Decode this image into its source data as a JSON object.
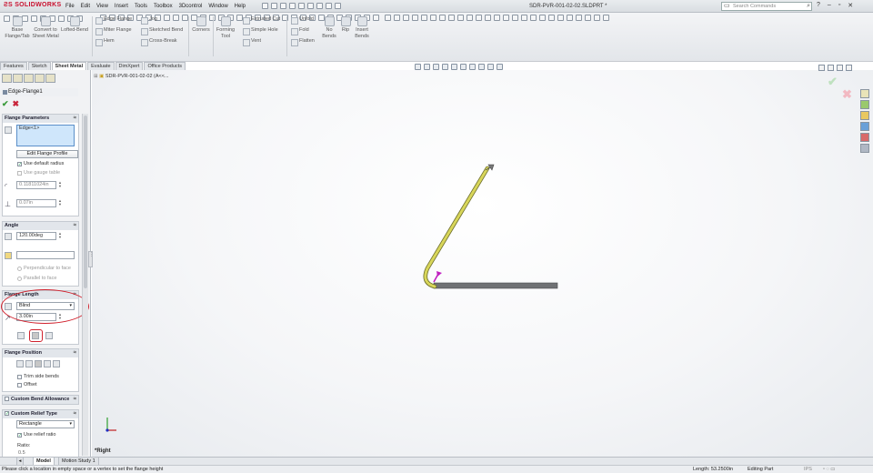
{
  "app": {
    "name": "SOLIDWORKS",
    "document_title": "SDR-PVR-001-02-02.SLDPRT *"
  },
  "menu": [
    "File",
    "Edit",
    "View",
    "Insert",
    "Tools",
    "Toolbox",
    "3Dcontrol",
    "Window",
    "Help"
  ],
  "search": {
    "placeholder": "Search Commands"
  },
  "commands": {
    "base_flange": "Base Flange/Tab",
    "convert": "Convert to Sheet Metal",
    "lofted": "Lofted-Bend",
    "edge_flange": "Edge Flange",
    "miter_flange": "Miter Flange",
    "hem": "Hem",
    "jog": "Jog",
    "sketched_bend": "Sketched Bend",
    "cross_break": "Cross-Break",
    "corners": "Corners",
    "forming_tool": "Forming Tool",
    "extruded_cut": "Extruded Cut",
    "simple_hole": "Simple Hole",
    "vent": "Vent",
    "unfold": "Unfold",
    "fold": "Fold",
    "flatten": "Flatten",
    "no_bends": "No Bends",
    "rip": "Rip",
    "insert_bends": "Insert Bends"
  },
  "tabs": [
    "Features",
    "Sketch",
    "Sheet Metal",
    "Evaluate",
    "DimXpert",
    "Office Products"
  ],
  "active_tab": "Sheet Metal",
  "property_manager": {
    "title": "Edge-Flange1",
    "flange_parameters": {
      "header": "Flange Parameters",
      "edge": "Edge<1>",
      "edit_profile": "Edit Flange Profile",
      "use_default_radius": "Use default radius",
      "use_gauge_table": "Use gauge table",
      "radius": "0.11811024in",
      "thickness": "0.07in"
    },
    "angle": {
      "header": "Angle",
      "value": "120.00deg",
      "perpendicular": "Perpendicular to face",
      "parallel": "Parallel to face"
    },
    "flange_length": {
      "header": "Flange Length",
      "end_condition": "Blind",
      "value": "3.00in"
    },
    "flange_position": {
      "header": "Flange Position",
      "trim_side_bends": "Trim side bends",
      "offset": "Offset"
    },
    "custom_bend_allowance": {
      "header": "Custom Bend Allowance"
    },
    "custom_relief_type": {
      "header": "Custom Relief Type",
      "type": "Rectangle",
      "use_relief_ratio": "Use relief ratio",
      "ratio_label": "Ratio:",
      "ratio": "0.5"
    }
  },
  "tree": {
    "part": "SDR-PVR-001-02-02  (A<<..."
  },
  "view": {
    "name": "*Right"
  },
  "bottom_tabs": [
    "Model",
    "Motion Study 1"
  ],
  "status": {
    "message": "Please click a location in empty space or a vertex to set the flange height",
    "length": "Length: 53.2500in",
    "mode": "Editing Part",
    "units": "IPS"
  },
  "colors": {
    "flange_highlight": "#d8d65a",
    "part_edge": "#6f7174",
    "annotation": "#d0202c",
    "arrow": "#c020c0"
  }
}
